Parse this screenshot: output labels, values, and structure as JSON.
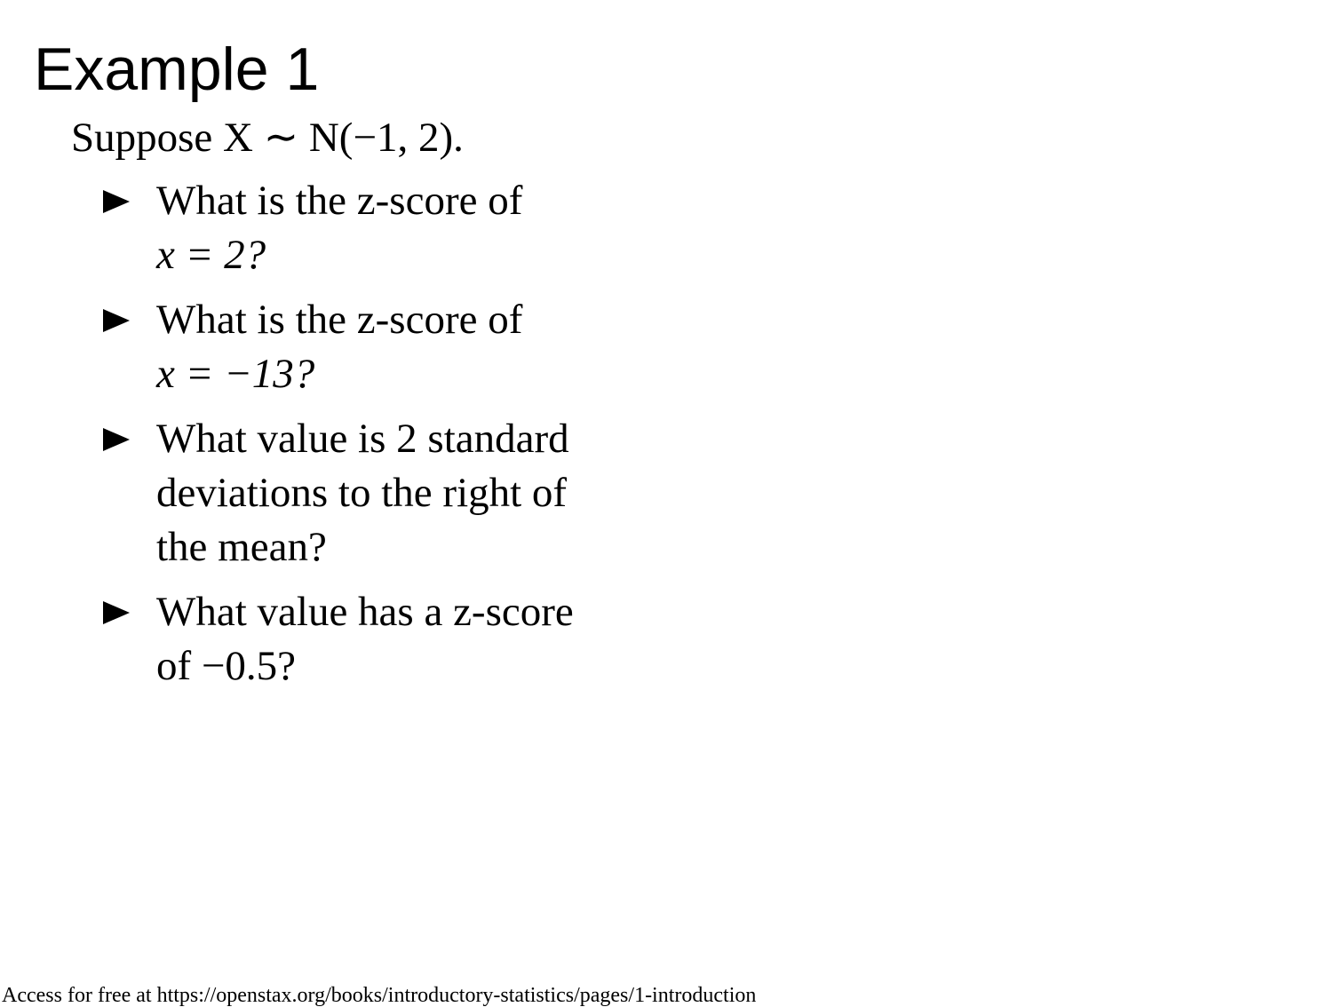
{
  "slide": {
    "title": "Example 1",
    "intro": "Suppose X ∼ N(−1, 2).",
    "bullets": [
      {
        "lines": [
          "What is the z-score of",
          "x = 2?"
        ]
      },
      {
        "lines": [
          "What is the z-score of",
          "x = −13?"
        ]
      },
      {
        "lines": [
          "What value is 2 standard",
          "deviations to the right of",
          "the mean?"
        ]
      },
      {
        "lines": [
          "What value has a z-score",
          "of −0.5?"
        ]
      }
    ],
    "bullet_icon": "triangle-right-icon",
    "footer": "Access for free at https://openstax.org/books/introductory-statistics/pages/1-introduction"
  }
}
